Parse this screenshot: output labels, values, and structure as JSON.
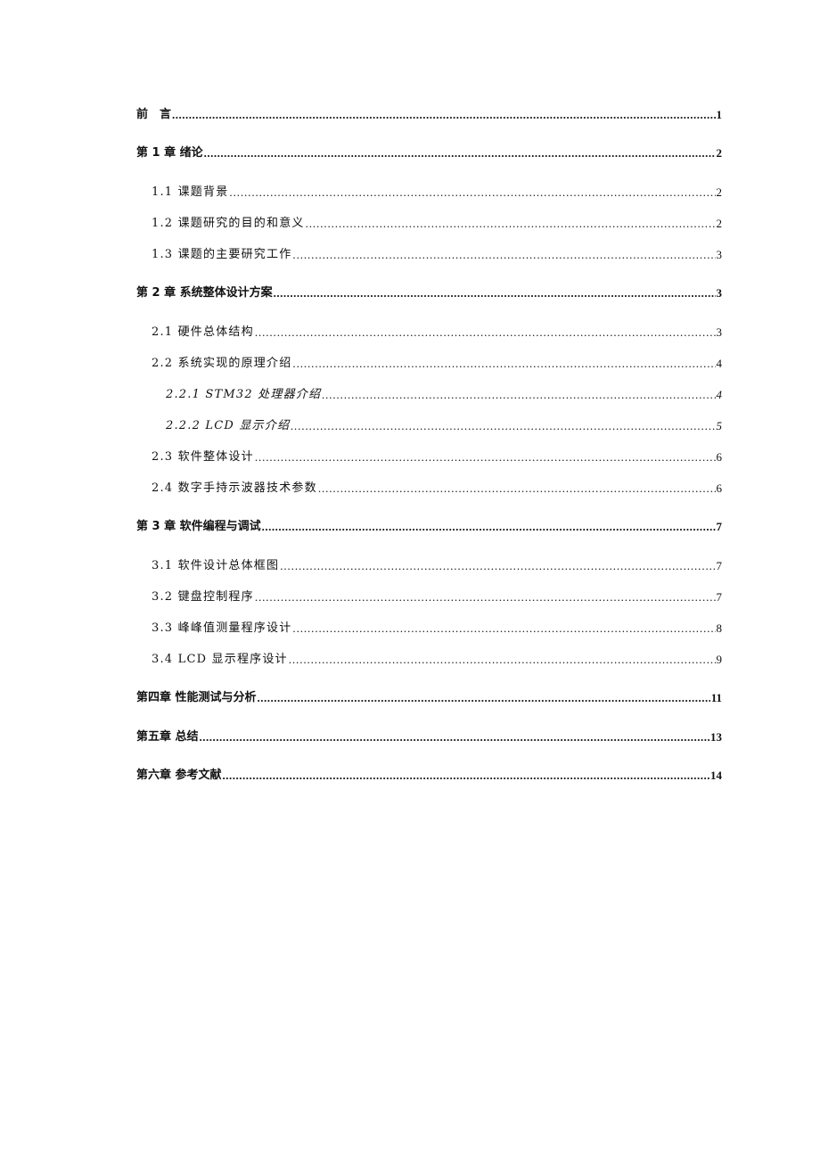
{
  "toc": {
    "entries": [
      {
        "level": 1,
        "title": "前　言",
        "page": "1"
      },
      {
        "level": 1,
        "title": "第 1 章  绪论",
        "page": "2"
      },
      {
        "level": 2,
        "title": "1.1 课题背景",
        "page": "2"
      },
      {
        "level": 2,
        "title": "1.2 课题研究的目的和意义",
        "page": "2"
      },
      {
        "level": 2,
        "title": "1.3 课题的主要研究工作",
        "page": "3"
      },
      {
        "level": 1,
        "title": "第 2 章  系统整体设计方案",
        "page": "3"
      },
      {
        "level": 2,
        "title": "2.1 硬件总体结构",
        "page": "3"
      },
      {
        "level": 2,
        "title": "2.2 系统实现的原理介绍",
        "page": "4"
      },
      {
        "level": 3,
        "title": "2.2.1 STM32 处理器介绍",
        "page": "4"
      },
      {
        "level": 3,
        "title": "2.2.2 LCD 显示介绍",
        "page": "5"
      },
      {
        "level": 2,
        "title": "2.3 软件整体设计",
        "page": "6"
      },
      {
        "level": 2,
        "title": "2.4 数字手持示波器技术参数",
        "page": "6"
      },
      {
        "level": 1,
        "title": "第 3 章  软件编程与调试",
        "page": "7"
      },
      {
        "level": 2,
        "title": "3.1 软件设计总体框图",
        "page": "7"
      },
      {
        "level": 2,
        "title": "3.2 键盘控制程序",
        "page": "7"
      },
      {
        "level": 2,
        "title": "3.3 峰峰值测量程序设计",
        "page": "8"
      },
      {
        "level": 2,
        "title": "3.4 LCD 显示程序设计",
        "page": "9"
      },
      {
        "level": 1,
        "title": "第四章  性能测试与分析",
        "page": "11"
      },
      {
        "level": 1,
        "title": "第五章  总结",
        "page": "13"
      },
      {
        "level": 1,
        "title": "第六章  参考文献",
        "page": "14"
      }
    ]
  }
}
